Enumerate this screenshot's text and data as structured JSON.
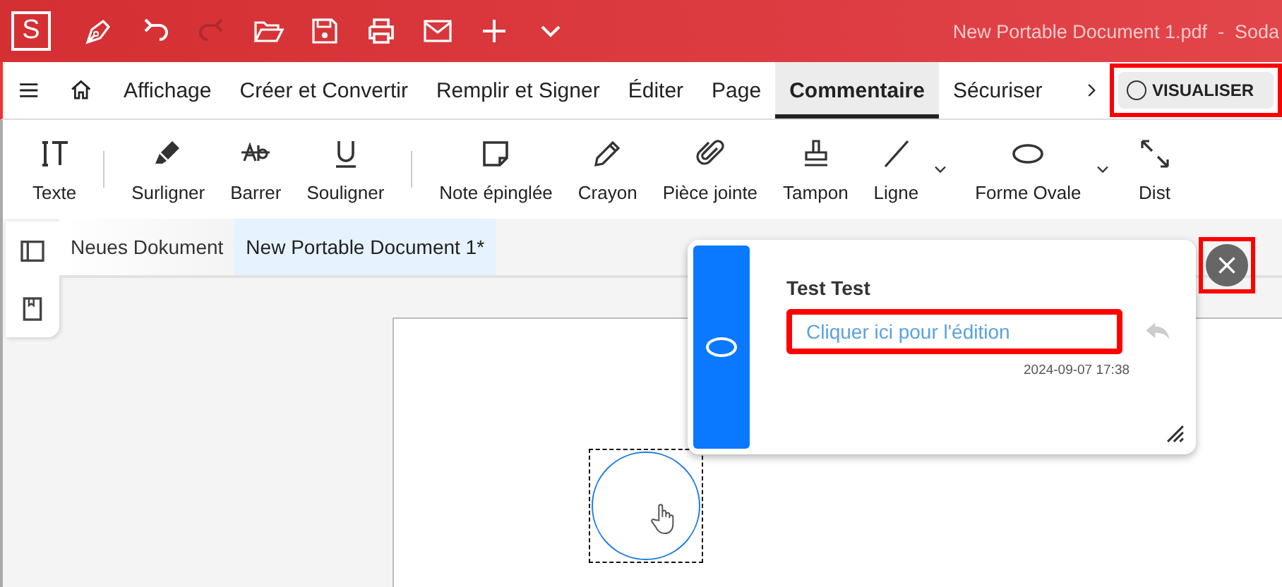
{
  "title_bar": {
    "logo": "S",
    "title": "New Portable Document 1.pdf  -  Soda"
  },
  "menu": {
    "tabs": [
      {
        "label": "Affichage",
        "selected": false
      },
      {
        "label": "Créer et Convertir",
        "selected": false
      },
      {
        "label": "Remplir et Signer",
        "selected": false
      },
      {
        "label": "Éditer",
        "selected": false
      },
      {
        "label": "Page",
        "selected": false
      },
      {
        "label": "Commentaire",
        "selected": true
      },
      {
        "label": "Sécuriser",
        "selected": false
      }
    ],
    "visualiser": {
      "label": "VISUALISER",
      "highlighted": true
    }
  },
  "toolbar": [
    {
      "kind": "tool",
      "label": "Texte",
      "dropdown": false
    },
    {
      "kind": "separator"
    },
    {
      "kind": "tool",
      "label": "Surligner",
      "dropdown": false
    },
    {
      "kind": "tool",
      "label": "Barrer",
      "dropdown": false
    },
    {
      "kind": "tool",
      "label": "Souligner",
      "dropdown": false
    },
    {
      "kind": "separator"
    },
    {
      "kind": "tool",
      "label": "Note épinglée",
      "dropdown": false
    },
    {
      "kind": "tool",
      "label": "Crayon",
      "dropdown": false
    },
    {
      "kind": "tool",
      "label": "Pièce jointe",
      "dropdown": false
    },
    {
      "kind": "tool",
      "label": "Tampon",
      "dropdown": false
    },
    {
      "kind": "tool",
      "label": "Ligne",
      "dropdown": true
    },
    {
      "kind": "tool",
      "label": "Forme Ovale",
      "dropdown": true
    },
    {
      "kind": "tool",
      "label": "Dist",
      "dropdown": false
    }
  ],
  "document_tabs": [
    {
      "label": "Neues Dokument",
      "selected": false
    },
    {
      "label": "New Portable Document 1*",
      "selected": true
    }
  ],
  "comment": {
    "author": "Test Test",
    "placeholder": "Cliquer ici pour l'édition",
    "field_highlighted": true,
    "timestamp": "2024-09-07 17:38",
    "close_highlighted": true
  }
}
